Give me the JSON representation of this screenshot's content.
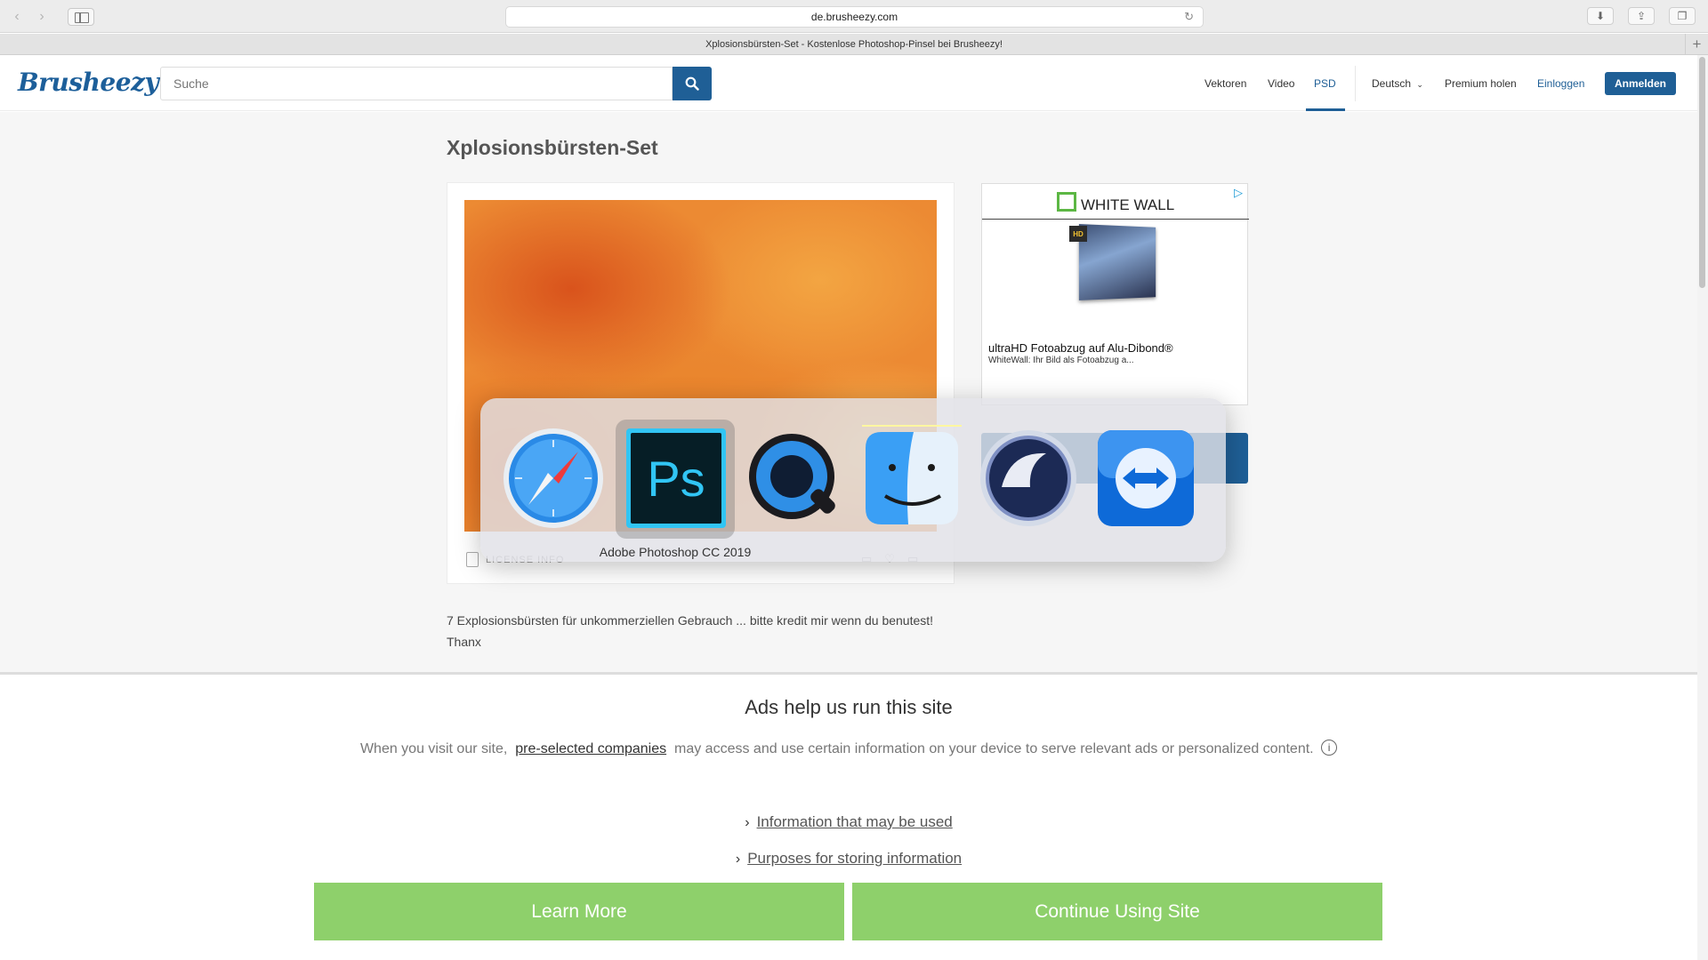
{
  "browser": {
    "url": "de.brusheezy.com",
    "tab_title": "Xplosionsbürsten-Set - Kostenlose Photoshop-Pinsel bei Brusheezy!",
    "back_icon": "chevron-left-icon",
    "forward_icon": "chevron-right-icon"
  },
  "header": {
    "logo": "Brusheezy",
    "search_placeholder": "Suche",
    "nav": {
      "vectors": "Vektoren",
      "video": "Video",
      "psd": "PSD",
      "language": "Deutsch",
      "premium": "Premium holen",
      "login": "Einloggen",
      "signup": "Anmelden"
    },
    "accent_color": "#1f5f96"
  },
  "main": {
    "title": "Xplosionsbürsten-Set",
    "license_label": "LICENSE INFO",
    "description": "7 Explosionsbürsten für unkommerziellen Gebrauch ... bitte kredit mir wenn du benutest!",
    "description_line2": "Thanx"
  },
  "ad": {
    "brand": "WHITE WALL",
    "badge": "HD",
    "headline": "ultraHD Fotoabzug auf Alu-Dibond®",
    "subline": "WhiteWall: Ihr Bild als Fotoabzug a..."
  },
  "app_switcher": {
    "apps": [
      "Safari",
      "Adobe Photoshop CC 2019",
      "QuickTime Player",
      "Finder",
      "Cinema 4D",
      "TeamViewer"
    ],
    "selected_label": "Adobe Photoshop CC 2019",
    "ps_label": "Ps"
  },
  "consent": {
    "title": "Ads help us run this site",
    "text_before": "When you visit our site,",
    "link": "pre-selected companies",
    "text_after": "may access and use certain information on your device to serve relevant ads or personalized content.",
    "info_icon": "i",
    "expander1": "Information that may be used",
    "expander2": "Purposes for storing information",
    "learn_more": "Learn More",
    "continue": "Continue Using Site",
    "button_color": "#8ed06b"
  }
}
